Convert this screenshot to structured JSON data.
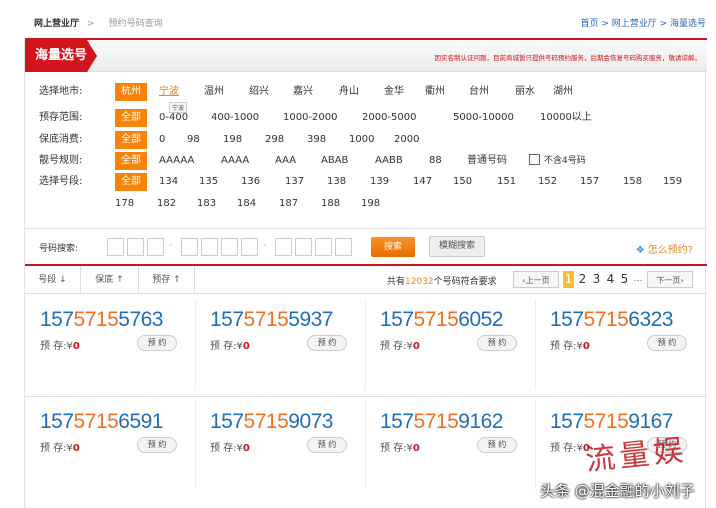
{
  "breadcrumb_top": {
    "section": "网上营业厅",
    "sep": ">",
    "page": "预约号码查询",
    "right": "首页 > 网上营业厅 > 海量选号"
  },
  "header": {
    "title": "海量选号",
    "notice": "因实名制认证问题，目前商城暂只提供号码预约服务，后期会恢复号码购买服务，敬请谅解。"
  },
  "filters": {
    "city": {
      "label": "选择地市:",
      "options": [
        "杭州",
        "宁波",
        "温州",
        "绍兴",
        "嘉兴",
        "舟山",
        "金华",
        "衢州",
        "台州",
        "丽水",
        "湖州"
      ],
      "selected": "杭州",
      "hover": "宁波",
      "tooltip": "宁波"
    },
    "deposit": {
      "label": "预存范围:",
      "options": [
        "全部",
        "0-400",
        "400-1000",
        "1000-2000",
        "2000-5000",
        "5000-10000",
        "10000以上"
      ]
    },
    "minimum": {
      "label": "保底消费:",
      "options": [
        "全部",
        "0",
        "98",
        "198",
        "298",
        "398",
        "1000",
        "2000"
      ]
    },
    "rule": {
      "label": "靓号规则:",
      "options": [
        "全部",
        "AAAAA",
        "AAAA",
        "AAA",
        "ABAB",
        "AABB",
        "88",
        "普通号码"
      ],
      "checkbox_label": "不含4号码",
      "checkbox_checked": false
    },
    "prefix": {
      "label": "选择号段:",
      "options": [
        "全部",
        "134",
        "135",
        "136",
        "137",
        "138",
        "139",
        "147",
        "150",
        "151",
        "152",
        "157",
        "158",
        "159",
        "178",
        "182",
        "183",
        "184",
        "187",
        "188",
        "198"
      ]
    }
  },
  "search": {
    "label": "号码搜索:",
    "separator": "-",
    "search_button": "搜索",
    "fuzzy_button": "模糊搜索",
    "how_link": "怎么预约?",
    "how_icon": "diamond-icon"
  },
  "sort": {
    "items": [
      "号段 ↓",
      "保底 ↑",
      "预存 ↑"
    ],
    "count_prefix": "共有",
    "count": "12032",
    "count_suffix": "个号码符合要求",
    "prev": "‹上一页",
    "next": "下一页›",
    "pages": [
      "1",
      "2",
      "3",
      "4",
      "5"
    ],
    "current_page": "1",
    "ellipsis": "…"
  },
  "numbers": [
    {
      "a": "157",
      "b": "5715",
      "c": "5763",
      "deposit_label": "预 存:¥",
      "deposit": "0",
      "button": "预 约"
    },
    {
      "a": "157",
      "b": "5715",
      "c": "5937",
      "deposit_label": "预 存:¥",
      "deposit": "0",
      "button": "预 约"
    },
    {
      "a": "157",
      "b": "5715",
      "c": "6052",
      "deposit_label": "预 存:¥",
      "deposit": "0",
      "button": "预 约"
    },
    {
      "a": "157",
      "b": "5715",
      "c": "6323",
      "deposit_label": "预 存:¥",
      "deposit": "0",
      "button": "预 约"
    },
    {
      "a": "157",
      "b": "5715",
      "c": "6591",
      "deposit_label": "预 存:¥",
      "deposit": "0",
      "button": "预 约"
    },
    {
      "a": "157",
      "b": "5715",
      "c": "9073",
      "deposit_label": "预 存:¥",
      "deposit": "0",
      "button": "预 约"
    },
    {
      "a": "157",
      "b": "5715",
      "c": "9162",
      "deposit_label": "预 存:¥",
      "deposit": "0",
      "button": "预 约"
    },
    {
      "a": "157",
      "b": "5715",
      "c": "9167",
      "deposit_label": "预 存:¥",
      "deposit": "0",
      "button": "预 约"
    }
  ],
  "watermark": "头条 @混金融的小刘子",
  "stamp": "流量娱",
  "colors": {
    "brand_red": "#d0161c",
    "accent_orange": "#f5840c",
    "number_blue": "#1c6fb8",
    "page_current": "#f6c12b"
  }
}
